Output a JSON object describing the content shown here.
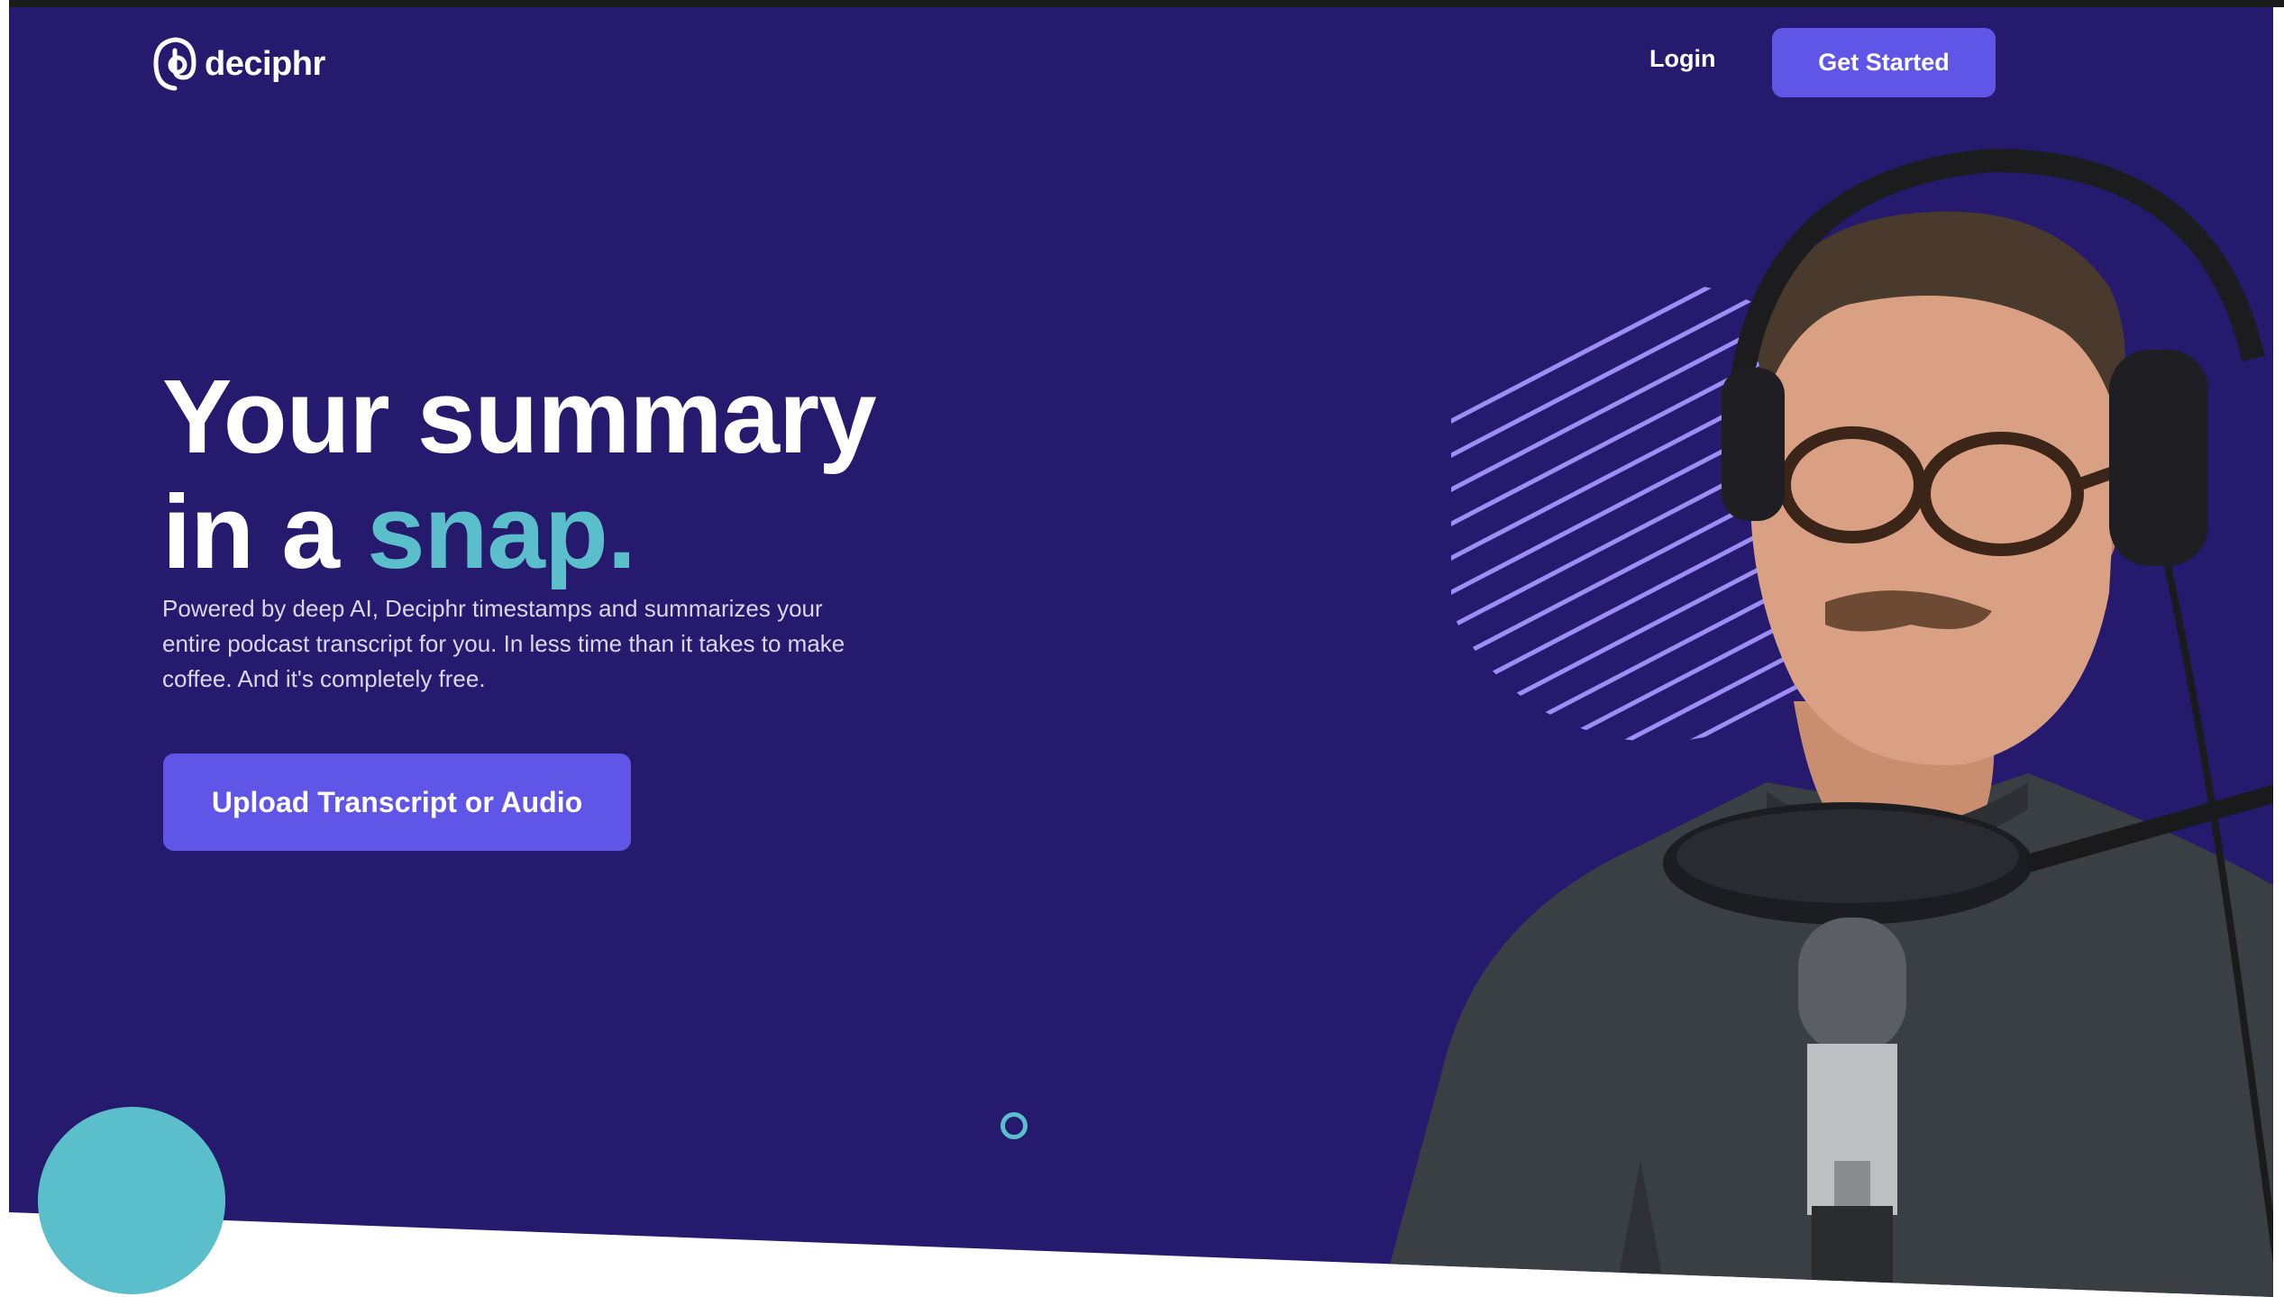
{
  "brand": {
    "name": "deciphr",
    "logo_icon": "deciphr-logo-icon"
  },
  "nav": {
    "login_label": "Login",
    "cta_label": "Get Started"
  },
  "hero": {
    "headline_line1": "Your summary",
    "headline_line2_prefix": "in a ",
    "headline_accent": "snap.",
    "description": "Powered by deep AI, Deciphr timestamps and summarizes your entire podcast transcript for you. In less time than it takes to make coffee. And it's completely free.",
    "upload_label": "Upload Transcript or Audio"
  },
  "colors": {
    "background": "#261a6e",
    "accent_teal": "#5bbfcb",
    "button_purple": "#5f55e6",
    "stripe_lavender": "#9b8ff5"
  }
}
